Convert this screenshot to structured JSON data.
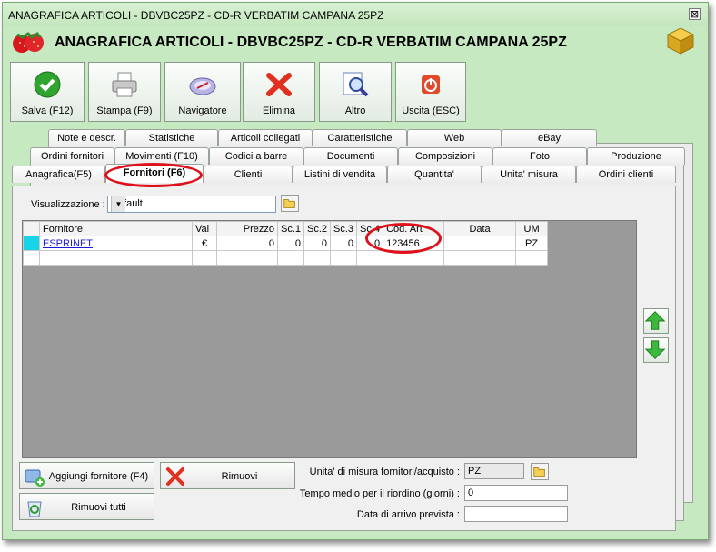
{
  "window": {
    "title": "ANAGRAFICA ARTICOLI - DBVBC25PZ - CD-R VERBATIM CAMPANA 25PZ",
    "close_glyph": "⊠"
  },
  "header": {
    "title": "ANAGRAFICA ARTICOLI - DBVBC25PZ - CD-R VERBATIM CAMPANA 25PZ"
  },
  "toolbar": {
    "save_label": "Salva (F12)",
    "print_label": "Stampa (F9)",
    "navigator_label": "Navigatore",
    "delete_label": "Elimina",
    "other_label": "Altro",
    "exit_label": "Uscita (ESC)"
  },
  "tabs": {
    "row1": [
      "Note e descr.",
      "Statistiche",
      "Articoli collegati",
      "Caratteristiche",
      "Web",
      "eBay"
    ],
    "row2": [
      "Ordini fornitori",
      "Movimenti (F10)",
      "Codici a barre",
      "Documenti",
      "Composizioni",
      "Foto",
      "Produzione"
    ],
    "row3": [
      "Anagrafica(F5)",
      "Fornitori (F6)",
      "Clienti",
      "Listini di vendita",
      "Quantita'",
      "Unita' misura",
      "Ordini clienti"
    ],
    "active": "Fornitori (F6)"
  },
  "view": {
    "label": "Visualizzazione :",
    "value": "Default"
  },
  "grid": {
    "columns": [
      "Fornitore",
      "Val",
      "Prezzo",
      "Sc.1",
      "Sc.2",
      "Sc.3",
      "Sc.4",
      "Cod. Art",
      "Data",
      "UM"
    ],
    "rows": [
      [
        "ESPRINET",
        "€",
        "0",
        "0",
        "0",
        "0",
        "0",
        "123456",
        "",
        "PZ"
      ]
    ]
  },
  "buttons": {
    "add_supplier": "Aggiungi fornitore (F4)",
    "remove": "Rimuovi",
    "remove_all": "Rimuovi tutti"
  },
  "fields": {
    "unit_label": "Unita' di misura fornitori/acquisto :",
    "unit_value": "PZ",
    "reorder_label": "Tempo medio per il riordino (giorni) :",
    "reorder_value": "0",
    "arrival_label": "Data di arrivo prevista :",
    "arrival_value": ""
  },
  "colors": {
    "window_bg": "#c7e9c2",
    "highlight": "#e0101a",
    "grid_bg": "#9a9a9a"
  }
}
